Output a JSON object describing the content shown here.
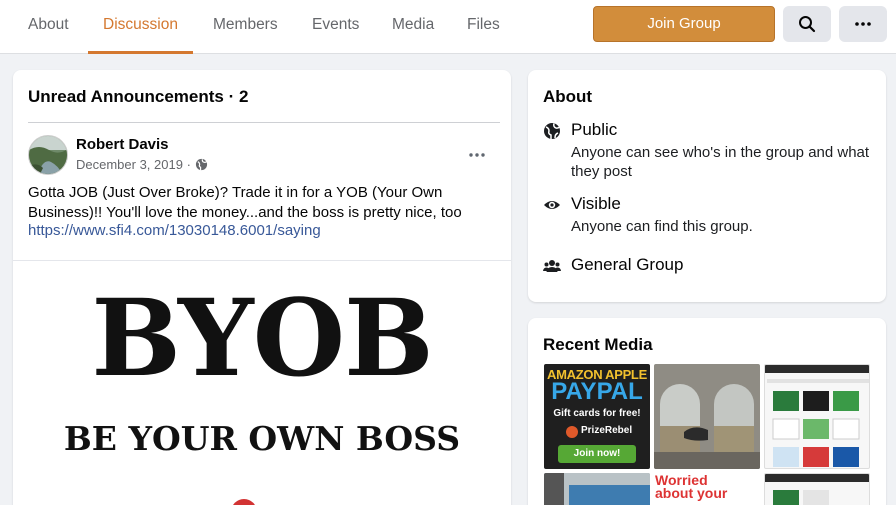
{
  "tabs": [
    {
      "label": "About",
      "active": false
    },
    {
      "label": "Discussion",
      "active": true
    },
    {
      "label": "Members",
      "active": false
    },
    {
      "label": "Events",
      "active": false
    },
    {
      "label": "Media",
      "active": false
    },
    {
      "label": "Files",
      "active": false
    }
  ],
  "header": {
    "join_label": "Join Group",
    "search_icon": "search-icon",
    "more_icon": "more-icon"
  },
  "colors": {
    "accent": "#d4782f",
    "join_button": "#d28d3b",
    "link": "#385898"
  },
  "announcements": {
    "title": "Unread Announcements · 2",
    "post": {
      "author": "Robert Davis",
      "date": "December 3, 2019 ·",
      "privacy_icon": "globe-icon",
      "text": "Gotta JOB (Just Over Broke)? Trade it in for a YOB (Your Own Business)!! You'll love the money...and the boss is pretty nice, too",
      "link": "https://www.sfi4.com/13030148.6001/saying",
      "image_text_main": "BYOB",
      "image_text_sub": "BE YOUR OWN BOSS"
    }
  },
  "about": {
    "title": "About",
    "items": [
      {
        "icon": "globe-icon",
        "title": "Public",
        "desc": "Anyone can see who's in the group and what they post"
      },
      {
        "icon": "eye-icon",
        "title": "Visible",
        "desc": "Anyone can find this group."
      },
      {
        "icon": "people-icon",
        "title": "General Group",
        "desc": ""
      }
    ]
  },
  "recent_media": {
    "title": "Recent Media",
    "thumb1": {
      "line1": "AMAZON APPLE",
      "line2": "PAYPAL",
      "line3": "Gift cards for free!",
      "brand": "PrizeRebel",
      "cta": "Join now!"
    },
    "thumb5": {
      "line1": "Worried",
      "line2": "about your"
    }
  }
}
